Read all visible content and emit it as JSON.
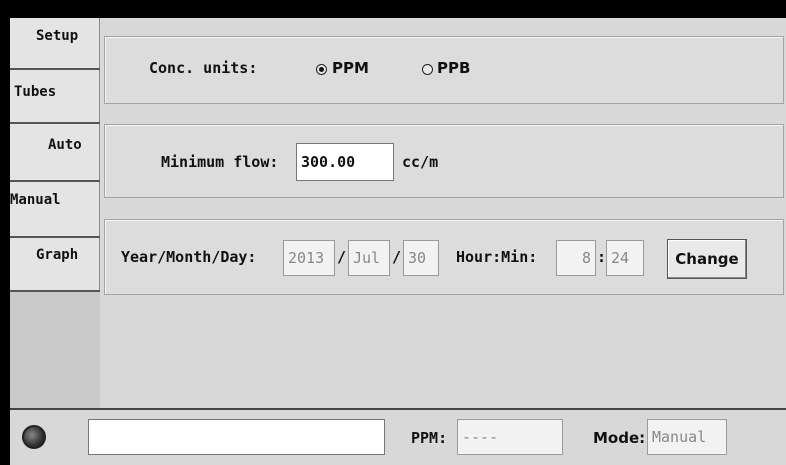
{
  "tabs": [
    {
      "label": "Setup"
    },
    {
      "label": "Tubes"
    },
    {
      "label": "Auto"
    },
    {
      "label": "Manual"
    },
    {
      "label": "Graph"
    }
  ],
  "units": {
    "label": "Conc. units:",
    "options": [
      {
        "label": "PPM",
        "selected": true
      },
      {
        "label": "PPB",
        "selected": false
      }
    ]
  },
  "flow": {
    "label": "Minimum flow:",
    "value": "300.00",
    "unit": "cc/m"
  },
  "datetime": {
    "date_label": "Year/Month/Day:",
    "year": "2013",
    "month": "Jul",
    "day": "30",
    "sep1": "/",
    "sep2": "/",
    "time_label": "Hour:Min:",
    "hour": "8",
    "time_sep": ":",
    "minute": "24",
    "change_label": "Change"
  },
  "status": {
    "message": "",
    "ppm_label": "PPM:",
    "ppm_value": "----",
    "mode_label": "Mode:",
    "mode_value": "Manual"
  }
}
